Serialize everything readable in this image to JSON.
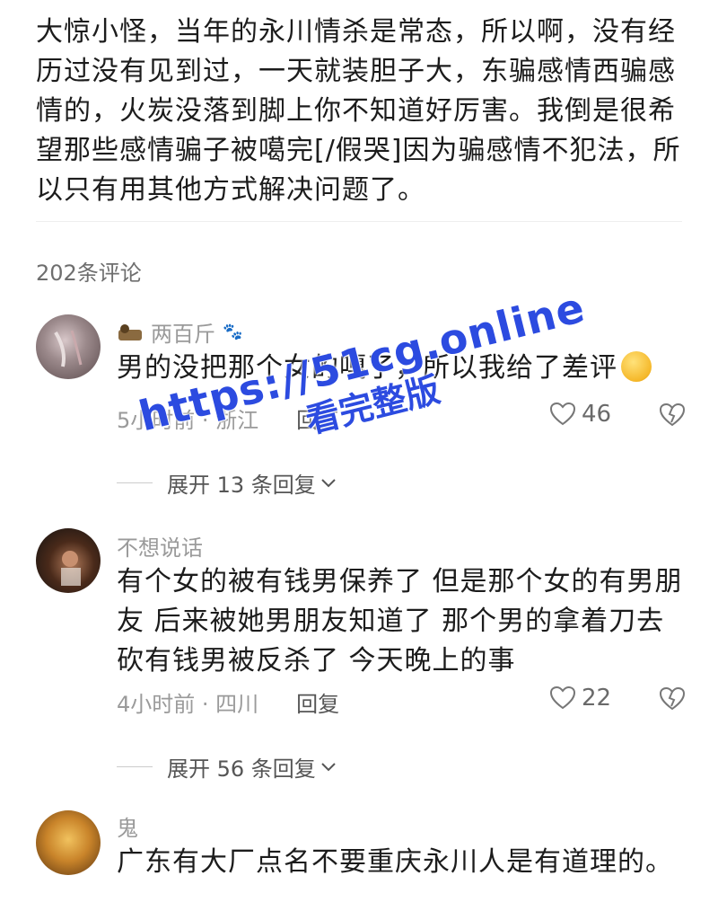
{
  "post": {
    "body": "大惊小怪，当年的永川情杀是常态，所以啊，没有经历过没有见到过，一天就装胆子大，东骗感情西骗感情的，火炭没落到脚上你不知道好厉害。我倒是很希望那些感情骗子被噶完[/假哭]因为骗感情不犯法，所以只有用其他方式解决问题了。"
  },
  "comments_header": {
    "count_label": "202条评论"
  },
  "comments": [
    {
      "username": "两百斤",
      "text": "男的没把那个女的嘎了，所以我给了差评",
      "time_location": "5小时前 · 浙江",
      "reply_label": "回复",
      "likes": "46",
      "expand_label": "展开 13 条回复"
    },
    {
      "username": "不想说话",
      "text": "有个女的被有钱男保养了 但是那个女的有男朋友 后来被她男朋友知道了 那个男的拿着刀去砍有钱男被反杀了 今天晚上的事",
      "time_location": "4小时前 · 四川",
      "reply_label": "回复",
      "likes": "22",
      "expand_label": "展开 56 条回复"
    },
    {
      "username": "鬼",
      "text": "广东有大厂点名不要重庆永川人是有道理的。"
    }
  ],
  "watermark": {
    "url": "https://51cg.online",
    "subtitle": "看完整版"
  },
  "colors": {
    "watermark": "#2c4be0",
    "meta_text": "#9a9a9a",
    "body_text": "#1c1c1c"
  }
}
